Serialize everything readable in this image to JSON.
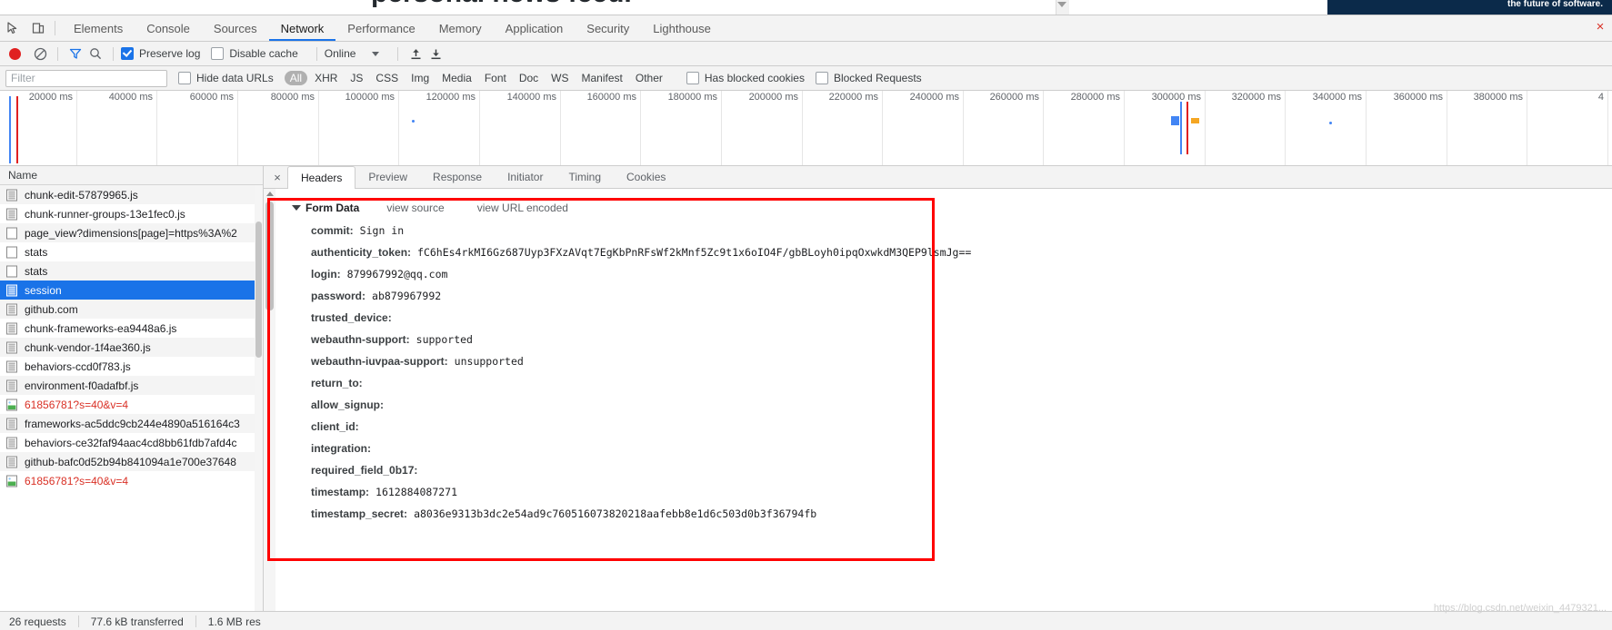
{
  "page": {
    "headline": "personal news feed.",
    "banner_text": "the future of software.",
    "tab_link": "..."
  },
  "devtools": {
    "tabs": [
      {
        "label": "Elements",
        "active": false
      },
      {
        "label": "Console",
        "active": false
      },
      {
        "label": "Sources",
        "active": false
      },
      {
        "label": "Network",
        "active": true
      },
      {
        "label": "Performance",
        "active": false
      },
      {
        "label": "Memory",
        "active": false
      },
      {
        "label": "Application",
        "active": false
      },
      {
        "label": "Security",
        "active": false
      },
      {
        "label": "Lighthouse",
        "active": false
      }
    ],
    "close_label": "×"
  },
  "network_toolbar": {
    "preserve_log": {
      "label": "Preserve log",
      "checked": true
    },
    "disable_cache": {
      "label": "Disable cache",
      "checked": false
    },
    "throttle": "Online"
  },
  "filter_bar": {
    "filter_placeholder": "Filter",
    "filter_value": "",
    "hide_data_urls": {
      "label": "Hide data URLs",
      "checked": false
    },
    "types": [
      {
        "label": "All",
        "selected": true
      },
      {
        "label": "XHR",
        "selected": false
      },
      {
        "label": "JS",
        "selected": false
      },
      {
        "label": "CSS",
        "selected": false
      },
      {
        "label": "Img",
        "selected": false
      },
      {
        "label": "Media",
        "selected": false
      },
      {
        "label": "Font",
        "selected": false
      },
      {
        "label": "Doc",
        "selected": false
      },
      {
        "label": "WS",
        "selected": false
      },
      {
        "label": "Manifest",
        "selected": false
      },
      {
        "label": "Other",
        "selected": false
      }
    ],
    "has_blocked_cookies": {
      "label": "Has blocked cookies",
      "checked": false
    },
    "blocked_requests": {
      "label": "Blocked Requests",
      "checked": false
    }
  },
  "overview": {
    "tick_labels": [
      "20000 ms",
      "40000 ms",
      "60000 ms",
      "80000 ms",
      "100000 ms",
      "120000 ms",
      "140000 ms",
      "160000 ms",
      "180000 ms",
      "200000 ms",
      "220000 ms",
      "240000 ms",
      "260000 ms",
      "280000 ms",
      "300000 ms",
      "320000 ms",
      "340000 ms",
      "360000 ms",
      "380000 ms",
      "4"
    ]
  },
  "request_list": {
    "column_header": "Name",
    "rows": [
      {
        "name": "chunk-edit-57879965.js",
        "type": "script",
        "state": "normal"
      },
      {
        "name": "chunk-runner-groups-13e1fec0.js",
        "type": "script",
        "state": "normal"
      },
      {
        "name": "page_view?dimensions[page]=https%3A%2",
        "type": "xhr",
        "state": "normal"
      },
      {
        "name": "stats",
        "type": "xhr",
        "state": "normal"
      },
      {
        "name": "stats",
        "type": "xhr",
        "state": "normal"
      },
      {
        "name": "session",
        "type": "doc",
        "state": "selected"
      },
      {
        "name": "github.com",
        "type": "doc",
        "state": "normal"
      },
      {
        "name": "chunk-frameworks-ea9448a6.js",
        "type": "script",
        "state": "normal"
      },
      {
        "name": "chunk-vendor-1f4ae360.js",
        "type": "script",
        "state": "normal"
      },
      {
        "name": "behaviors-ccd0f783.js",
        "type": "script",
        "state": "normal"
      },
      {
        "name": "environment-f0adafbf.js",
        "type": "script",
        "state": "normal"
      },
      {
        "name": "61856781?s=40&v=4",
        "type": "image",
        "state": "error"
      },
      {
        "name": "frameworks-ac5ddc9cb244e4890a516164c3",
        "type": "script",
        "state": "normal"
      },
      {
        "name": "behaviors-ce32faf94aac4cd8bb61fdb7afd4c",
        "type": "script",
        "state": "normal"
      },
      {
        "name": "github-bafc0d52b94b841094a1e700e37648",
        "type": "script",
        "state": "normal"
      },
      {
        "name": "61856781?s=40&v=4",
        "type": "image",
        "state": "error"
      }
    ]
  },
  "detail": {
    "tabs": [
      {
        "label": "Headers",
        "active": true
      },
      {
        "label": "Preview",
        "active": false
      },
      {
        "label": "Response",
        "active": false
      },
      {
        "label": "Initiator",
        "active": false
      },
      {
        "label": "Timing",
        "active": false
      },
      {
        "label": "Cookies",
        "active": false
      }
    ],
    "close_label": "×",
    "form_data": {
      "section_title": "Form Data",
      "view_source_label": "view source",
      "view_url_encoded_label": "view URL encoded",
      "entries": [
        {
          "key": "commit:",
          "value": "Sign in"
        },
        {
          "key": "authenticity_token:",
          "value": "fC6hEs4rkMI6Gz687Uyp3FXzAVqt7EgKbPnRFsWf2kMnf5Zc9t1x6oIO4F/gbBLoyh0ipqOxwkdM3QEP9lsmJg=="
        },
        {
          "key": "login:",
          "value": "879967992@qq.com"
        },
        {
          "key": "password:",
          "value": "ab879967992"
        },
        {
          "key": "trusted_device:",
          "value": ""
        },
        {
          "key": "webauthn-support:",
          "value": "supported"
        },
        {
          "key": "webauthn-iuvpaa-support:",
          "value": "unsupported"
        },
        {
          "key": "return_to:",
          "value": ""
        },
        {
          "key": "allow_signup:",
          "value": ""
        },
        {
          "key": "client_id:",
          "value": ""
        },
        {
          "key": "integration:",
          "value": ""
        },
        {
          "key": "required_field_0b17:",
          "value": ""
        },
        {
          "key": "timestamp:",
          "value": "1612884087271"
        },
        {
          "key": "timestamp_secret:",
          "value": "a8036e9313b3dc2e54ad9c760516073820218aafebb8e1d6c503d0b3f36794fb"
        }
      ]
    }
  },
  "status_bar": {
    "requests": "26 requests",
    "transferred": "77.6 kB transferred",
    "resources": "1.6 MB res"
  },
  "watermark": "https://blog.csdn.net/weixin_4479321...",
  "colors": {
    "accent": "#1a73e8",
    "record": "#e02020",
    "error": "#d93025",
    "annotation": "#ff0000",
    "toolbar_bg": "#f3f3f3"
  }
}
